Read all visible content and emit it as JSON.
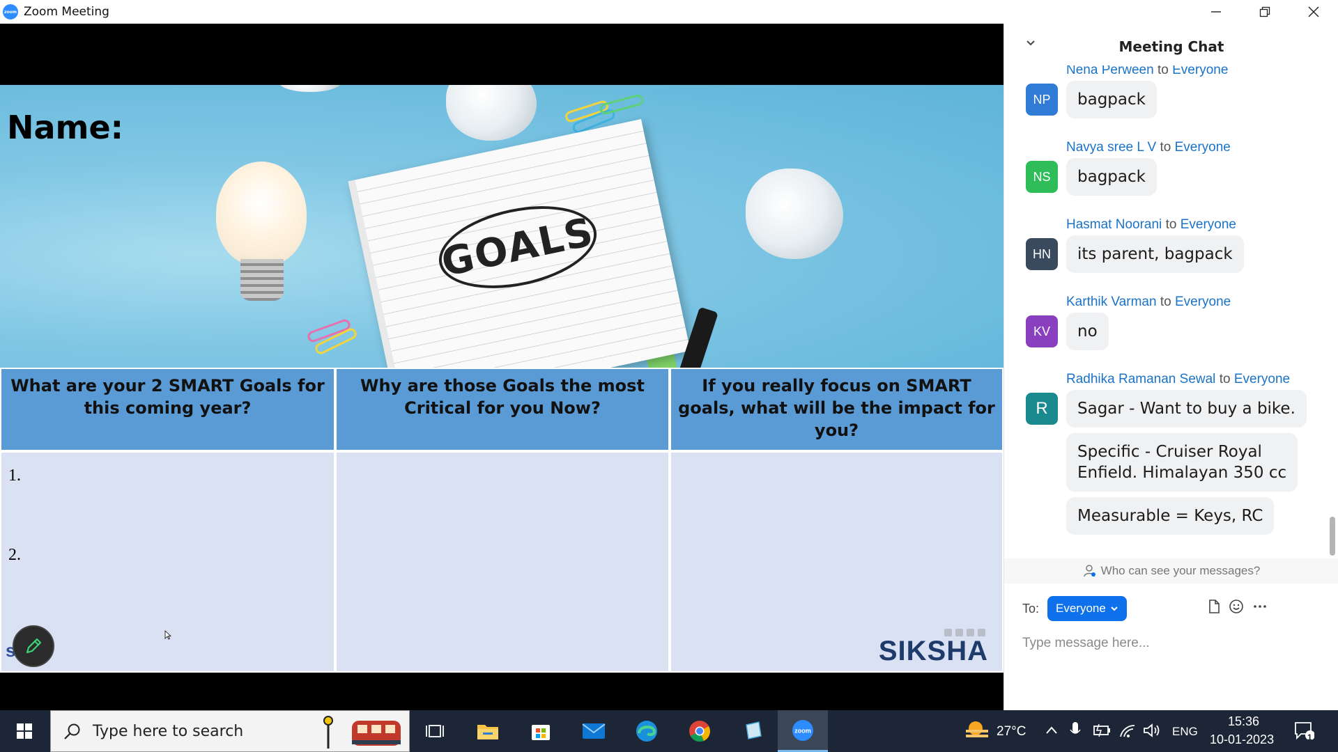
{
  "window": {
    "title": "Zoom Meeting",
    "controls": [
      "minimize",
      "restore",
      "close"
    ]
  },
  "slide": {
    "name_label": "Name:",
    "goals_text": "GOALS",
    "headers": [
      "What are your 2 SMART Goals for this coming year?",
      "Why are those Goals the most Critical for you Now?",
      "If you really focus on SMART goals, what will be the impact for you?"
    ],
    "row_numbers": [
      "1.",
      "2."
    ],
    "logo_text": "SIKSHA",
    "corner_logo_text": "stu"
  },
  "chat": {
    "title": "Meeting Chat",
    "messages": [
      {
        "initials": "NP",
        "sender": "Nena Perween",
        "to_word": "to",
        "recipient": "Everyone",
        "text": "bagpack",
        "color": "#2f7bd6"
      },
      {
        "initials": "NS",
        "sender": "Navya sree L V",
        "to_word": "to",
        "recipient": "Everyone",
        "text": "bagpack",
        "color": "#2ebd59"
      },
      {
        "initials": "HN",
        "sender": "Hasmat Noorani",
        "to_word": "to",
        "recipient": "Everyone",
        "text": "its parent, bagpack",
        "color": "#3a4a5e"
      },
      {
        "initials": "KV",
        "sender": "Karthik Varman",
        "to_word": "to",
        "recipient": "Everyone",
        "text": "no",
        "color": "#8a3fbf"
      },
      {
        "initials": "R",
        "sender": "Radhika Ramanan Sewal",
        "to_word": "to",
        "recipient": "Everyone",
        "text": "Sagar - Want to buy a bike.",
        "color": "#1b8a8f"
      }
    ],
    "extra_bubbles": [
      "Specific  - Cruiser Royal",
      "Enfield. Himalayan 350 cc",
      "Measurable = Keys, RC"
    ],
    "who_can_see": "Who can see your messages?",
    "to_label": "To:",
    "to_value": "Everyone",
    "input_placeholder": "Type message here..."
  },
  "taskbar": {
    "search_placeholder": "Type here to search",
    "apps": [
      "task-view",
      "file-explorer",
      "microsoft-store",
      "mail",
      "edge",
      "chrome",
      "notepad",
      "zoom"
    ],
    "temperature": "27°C",
    "language": "ENG",
    "time": "15:36",
    "date": "10-01-2023",
    "notification_count": "1"
  },
  "colors": {
    "accent": "#0e71eb",
    "slide_header": "#5b9bd5",
    "slide_cell": "#d9e1f2",
    "taskbar": "#1c2636"
  }
}
